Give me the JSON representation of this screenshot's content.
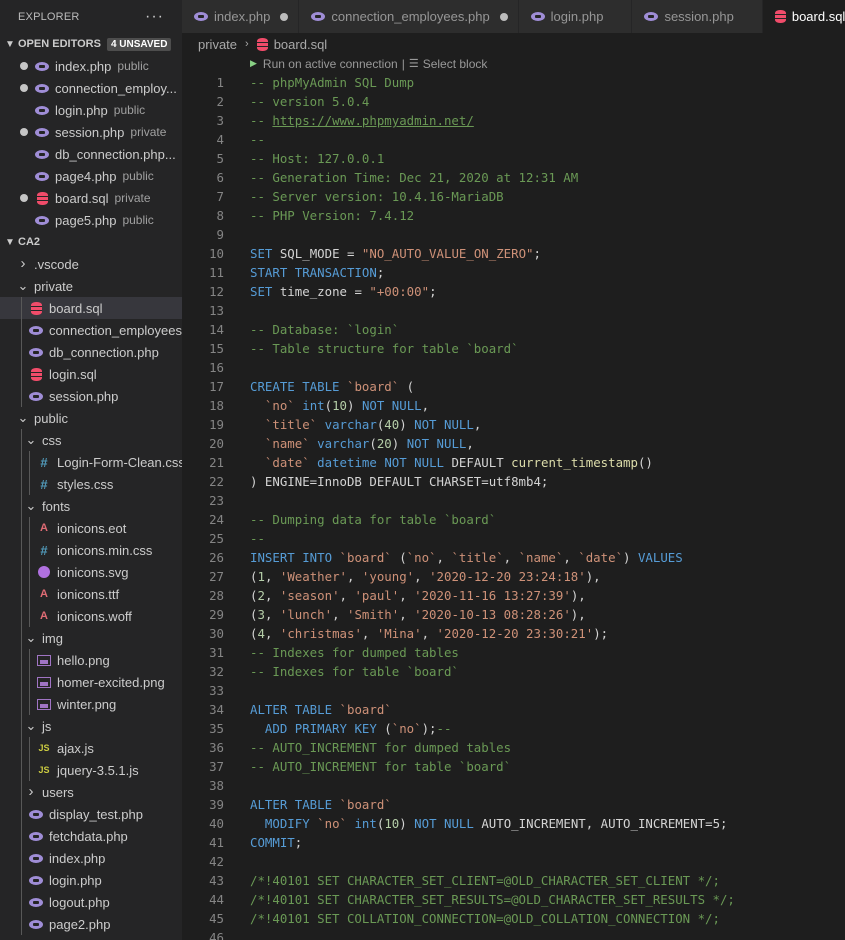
{
  "explorer": {
    "title": "EXPLORER",
    "more": "···",
    "open_editors": {
      "label": "OPEN EDITORS",
      "badge": "4 UNSAVED",
      "items": [
        {
          "name": "index.php",
          "desc": "public",
          "unsaved": true,
          "icon": "php"
        },
        {
          "name": "connection_employ...",
          "desc": "",
          "unsaved": true,
          "icon": "php"
        },
        {
          "name": "login.php",
          "desc": "public",
          "unsaved": false,
          "icon": "php"
        },
        {
          "name": "session.php",
          "desc": "private",
          "unsaved": true,
          "icon": "php"
        },
        {
          "name": "db_connection.php...",
          "desc": "",
          "unsaved": false,
          "icon": "php"
        },
        {
          "name": "page4.php",
          "desc": "public",
          "unsaved": false,
          "icon": "php"
        },
        {
          "name": "board.sql",
          "desc": "private",
          "unsaved": true,
          "icon": "sql"
        },
        {
          "name": "page5.php",
          "desc": "public",
          "unsaved": false,
          "icon": "php"
        }
      ]
    },
    "project": {
      "label": "CA2",
      "tree": [
        {
          "name": ".vscode",
          "type": "folder",
          "open": false,
          "depth": 0
        },
        {
          "name": "private",
          "type": "folder",
          "open": true,
          "depth": 0
        },
        {
          "name": "board.sql",
          "type": "sql",
          "depth": 1,
          "selected": true
        },
        {
          "name": "connection_employees...",
          "type": "php",
          "depth": 1
        },
        {
          "name": "db_connection.php",
          "type": "php",
          "depth": 1
        },
        {
          "name": "login.sql",
          "type": "sql",
          "depth": 1
        },
        {
          "name": "session.php",
          "type": "php",
          "depth": 1
        },
        {
          "name": "public",
          "type": "folder",
          "open": true,
          "depth": 0
        },
        {
          "name": "css",
          "type": "folder",
          "open": true,
          "depth": 1
        },
        {
          "name": "Login-Form-Clean.css",
          "type": "css",
          "depth": 2
        },
        {
          "name": "styles.css",
          "type": "css",
          "depth": 2
        },
        {
          "name": "fonts",
          "type": "folder",
          "open": true,
          "depth": 1
        },
        {
          "name": "ionicons.eot",
          "type": "font",
          "depth": 2
        },
        {
          "name": "ionicons.min.css",
          "type": "css",
          "depth": 2
        },
        {
          "name": "ionicons.svg",
          "type": "svg",
          "depth": 2
        },
        {
          "name": "ionicons.ttf",
          "type": "font",
          "depth": 2
        },
        {
          "name": "ionicons.woff",
          "type": "font",
          "depth": 2
        },
        {
          "name": "img",
          "type": "folder",
          "open": true,
          "depth": 1
        },
        {
          "name": "hello.png",
          "type": "img",
          "depth": 2
        },
        {
          "name": "homer-excited.png",
          "type": "img",
          "depth": 2
        },
        {
          "name": "winter.png",
          "type": "img",
          "depth": 2
        },
        {
          "name": "js",
          "type": "folder",
          "open": true,
          "depth": 1
        },
        {
          "name": "ajax.js",
          "type": "js",
          "depth": 2
        },
        {
          "name": "jquery-3.5.1.js",
          "type": "js",
          "depth": 2
        },
        {
          "name": "users",
          "type": "folder",
          "open": false,
          "depth": 1
        },
        {
          "name": "display_test.php",
          "type": "php",
          "depth": 1
        },
        {
          "name": "fetchdata.php",
          "type": "php",
          "depth": 1
        },
        {
          "name": "index.php",
          "type": "php",
          "depth": 1
        },
        {
          "name": "login.php",
          "type": "php",
          "depth": 1
        },
        {
          "name": "logout.php",
          "type": "php",
          "depth": 1
        },
        {
          "name": "page2.php",
          "type": "php",
          "depth": 1
        }
      ]
    }
  },
  "tabs": [
    {
      "label": "index.php",
      "icon": "php",
      "unsaved": true,
      "active": false
    },
    {
      "label": "connection_employees.php",
      "icon": "php",
      "unsaved": true,
      "active": false
    },
    {
      "label": "login.php",
      "icon": "php",
      "unsaved": false,
      "active": false
    },
    {
      "label": "session.php",
      "icon": "php",
      "unsaved": false,
      "active": false
    },
    {
      "label": "board.sql",
      "icon": "sql",
      "unsaved": false,
      "active": true
    }
  ],
  "breadcrumb": {
    "folder": "private",
    "separator": "›",
    "file": "board.sql"
  },
  "codelens": {
    "run": "Run on active connection",
    "divider": "|",
    "select": "Select block"
  },
  "colors": {
    "comment": "#6a9955",
    "keyword": "#569cd6",
    "string": "#ce9178",
    "number": "#b5cea8",
    "function": "#dcdcaa",
    "text": "#d4d4d4"
  },
  "code_lines": [
    [
      [
        "c",
        "-- phpMyAdmin SQL Dump"
      ]
    ],
    [
      [
        "c",
        "-- version 5.0.4"
      ]
    ],
    [
      [
        "c",
        "-- "
      ],
      [
        "u",
        "https://www.phpmyadmin.net/"
      ]
    ],
    [
      [
        "c",
        "--"
      ]
    ],
    [
      [
        "c",
        "-- Host: 127.0.0.1"
      ]
    ],
    [
      [
        "c",
        "-- Generation Time: Dec 21, 2020 at 12:31 AM"
      ]
    ],
    [
      [
        "c",
        "-- Server version: 10.4.16-MariaDB"
      ]
    ],
    [
      [
        "c",
        "-- PHP Version: 7.4.12"
      ]
    ],
    [],
    [
      [
        "k",
        "SET"
      ],
      [
        "p",
        " SQL_MODE = "
      ],
      [
        "s",
        "\"NO_AUTO_VALUE_ON_ZERO\""
      ],
      [
        "p",
        ";"
      ]
    ],
    [
      [
        "k",
        "START TRANSACTION"
      ],
      [
        "p",
        ";"
      ]
    ],
    [
      [
        "k",
        "SET"
      ],
      [
        "p",
        " time_zone = "
      ],
      [
        "s",
        "\"+00:00\""
      ],
      [
        "p",
        ";"
      ]
    ],
    [],
    [
      [
        "c",
        "-- Database: `login`"
      ]
    ],
    [
      [
        "c",
        "-- Table structure for table `board`"
      ]
    ],
    [],
    [
      [
        "k",
        "CREATE TABLE"
      ],
      [
        "p",
        " "
      ],
      [
        "s",
        "`board`"
      ],
      [
        "p",
        " ("
      ]
    ],
    [
      [
        "p",
        "  "
      ],
      [
        "s",
        "`no`"
      ],
      [
        "p",
        " "
      ],
      [
        "k",
        "int"
      ],
      [
        "p",
        "("
      ],
      [
        "n",
        "10"
      ],
      [
        "p",
        ") "
      ],
      [
        "k",
        "NOT NULL"
      ],
      [
        "p",
        ","
      ]
    ],
    [
      [
        "p",
        "  "
      ],
      [
        "s",
        "`title`"
      ],
      [
        "p",
        " "
      ],
      [
        "k",
        "varchar"
      ],
      [
        "p",
        "("
      ],
      [
        "n",
        "40"
      ],
      [
        "p",
        ") "
      ],
      [
        "k",
        "NOT NULL"
      ],
      [
        "p",
        ","
      ]
    ],
    [
      [
        "p",
        "  "
      ],
      [
        "s",
        "`name`"
      ],
      [
        "p",
        " "
      ],
      [
        "k",
        "varchar"
      ],
      [
        "p",
        "("
      ],
      [
        "n",
        "20"
      ],
      [
        "p",
        ") "
      ],
      [
        "k",
        "NOT NULL"
      ],
      [
        "p",
        ","
      ]
    ],
    [
      [
        "p",
        "  "
      ],
      [
        "s",
        "`date`"
      ],
      [
        "p",
        " "
      ],
      [
        "k",
        "datetime"
      ],
      [
        "p",
        " "
      ],
      [
        "k",
        "NOT NULL"
      ],
      [
        "p",
        " DEFAULT "
      ],
      [
        "f",
        "current_timestamp"
      ],
      [
        "p",
        "()"
      ]
    ],
    [
      [
        "p",
        ") ENGINE=InnoDB DEFAULT CHARSET=utf8mb4;"
      ]
    ],
    [],
    [
      [
        "c",
        "-- Dumping data for table `board`"
      ]
    ],
    [
      [
        "c",
        "--"
      ]
    ],
    [
      [
        "k",
        "INSERT INTO"
      ],
      [
        "p",
        " "
      ],
      [
        "s",
        "`board`"
      ],
      [
        "p",
        " ("
      ],
      [
        "s",
        "`no`"
      ],
      [
        "p",
        ", "
      ],
      [
        "s",
        "`title`"
      ],
      [
        "p",
        ", "
      ],
      [
        "s",
        "`name`"
      ],
      [
        "p",
        ", "
      ],
      [
        "s",
        "`date`"
      ],
      [
        "p",
        ") "
      ],
      [
        "k",
        "VALUES"
      ]
    ],
    [
      [
        "p",
        "("
      ],
      [
        "n",
        "1"
      ],
      [
        "p",
        ", "
      ],
      [
        "s",
        "'Weather'"
      ],
      [
        "p",
        ", "
      ],
      [
        "s",
        "'young'"
      ],
      [
        "p",
        ", "
      ],
      [
        "s",
        "'2020-12-20 23:24:18'"
      ],
      [
        "p",
        "),"
      ]
    ],
    [
      [
        "p",
        "("
      ],
      [
        "n",
        "2"
      ],
      [
        "p",
        ", "
      ],
      [
        "s",
        "'season'"
      ],
      [
        "p",
        ", "
      ],
      [
        "s",
        "'paul'"
      ],
      [
        "p",
        ", "
      ],
      [
        "s",
        "'2020-11-16 13:27:39'"
      ],
      [
        "p",
        "),"
      ]
    ],
    [
      [
        "p",
        "("
      ],
      [
        "n",
        "3"
      ],
      [
        "p",
        ", "
      ],
      [
        "s",
        "'lunch'"
      ],
      [
        "p",
        ", "
      ],
      [
        "s",
        "'Smith'"
      ],
      [
        "p",
        ", "
      ],
      [
        "s",
        "'2020-10-13 08:28:26'"
      ],
      [
        "p",
        "),"
      ]
    ],
    [
      [
        "p",
        "("
      ],
      [
        "n",
        "4"
      ],
      [
        "p",
        ", "
      ],
      [
        "s",
        "'christmas'"
      ],
      [
        "p",
        ", "
      ],
      [
        "s",
        "'Mina'"
      ],
      [
        "p",
        ", "
      ],
      [
        "s",
        "'2020-12-20 23:30:21'"
      ],
      [
        "p",
        ");"
      ]
    ],
    [
      [
        "c",
        "-- Indexes for dumped tables"
      ]
    ],
    [
      [
        "c",
        "-- Indexes for table `board`"
      ]
    ],
    [],
    [
      [
        "k",
        "ALTER TABLE"
      ],
      [
        "p",
        " "
      ],
      [
        "s",
        "`board`"
      ]
    ],
    [
      [
        "p",
        "  "
      ],
      [
        "k",
        "ADD PRIMARY KEY"
      ],
      [
        "p",
        " ("
      ],
      [
        "s",
        "`no`"
      ],
      [
        "p",
        ");"
      ],
      [
        "c",
        "--"
      ]
    ],
    [
      [
        "c",
        "-- AUTO_INCREMENT for dumped tables"
      ]
    ],
    [
      [
        "c",
        "-- AUTO_INCREMENT for table `board`"
      ]
    ],
    [],
    [
      [
        "k",
        "ALTER TABLE"
      ],
      [
        "p",
        " "
      ],
      [
        "s",
        "`board`"
      ]
    ],
    [
      [
        "p",
        "  "
      ],
      [
        "k",
        "MODIFY"
      ],
      [
        "p",
        " "
      ],
      [
        "s",
        "`no`"
      ],
      [
        "p",
        " "
      ],
      [
        "k",
        "int"
      ],
      [
        "p",
        "("
      ],
      [
        "n",
        "10"
      ],
      [
        "p",
        ") "
      ],
      [
        "k",
        "NOT NULL"
      ],
      [
        "p",
        " AUTO_INCREMENT, AUTO_INCREMENT=5;"
      ]
    ],
    [
      [
        "k",
        "COMMIT"
      ],
      [
        "p",
        ";"
      ]
    ],
    [],
    [
      [
        "c",
        "/*!40101 SET CHARACTER_SET_CLIENT=@OLD_CHARACTER_SET_CLIENT */;"
      ]
    ],
    [
      [
        "c",
        "/*!40101 SET CHARACTER_SET_RESULTS=@OLD_CHARACTER_SET_RESULTS */;"
      ]
    ],
    [
      [
        "c",
        "/*!40101 SET COLLATION_CONNECTION=@OLD_COLLATION_CONNECTION */;"
      ]
    ],
    []
  ]
}
